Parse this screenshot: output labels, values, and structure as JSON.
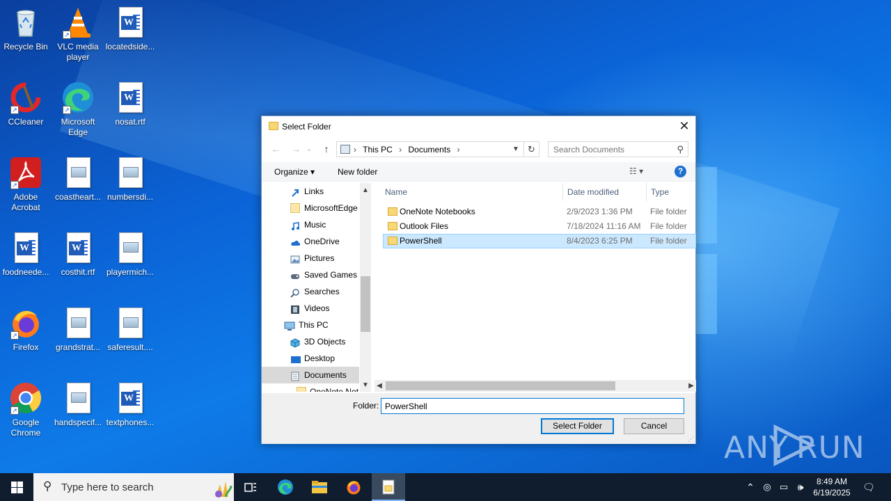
{
  "desktop": {
    "icons": [
      {
        "label": "Recycle Bin",
        "kind": "recycle"
      },
      {
        "label": "VLC media player",
        "kind": "vlc"
      },
      {
        "label": "locatedside...",
        "kind": "word"
      },
      {
        "label": "CCleaner",
        "kind": "ccleaner"
      },
      {
        "label": "Microsoft Edge",
        "kind": "edge"
      },
      {
        "label": "nosat.rtf",
        "kind": "word"
      },
      {
        "label": "Adobe Acrobat",
        "kind": "acrobat"
      },
      {
        "label": "coastheart...",
        "kind": "image"
      },
      {
        "label": "numbersdi...",
        "kind": "image"
      },
      {
        "label": "foodneede...",
        "kind": "word"
      },
      {
        "label": "costhit.rtf",
        "kind": "word"
      },
      {
        "label": "playermich...",
        "kind": "image"
      },
      {
        "label": "Firefox",
        "kind": "firefox"
      },
      {
        "label": "grandstrat...",
        "kind": "image"
      },
      {
        "label": "saferesult....",
        "kind": "image"
      },
      {
        "label": "Google Chrome",
        "kind": "chrome"
      },
      {
        "label": "handspecif...",
        "kind": "image"
      },
      {
        "label": "textphones...",
        "kind": "word"
      }
    ]
  },
  "dialog": {
    "title": "Select Folder",
    "close_glyph": "✕",
    "nav": {
      "back": "←",
      "forward": "→",
      "recent": "⌄",
      "up": "↑"
    },
    "address": {
      "crumbs": [
        "This PC",
        "Documents"
      ],
      "sep": "›"
    },
    "search_placeholder": "Search Documents",
    "toolbar": {
      "organize": "Organize ▾",
      "new_folder": "New folder",
      "view": "☷ ▾",
      "help": "?"
    },
    "nav_tree": [
      {
        "label": "Links",
        "icon": "links-icon",
        "indent": 1
      },
      {
        "label": "MicrosoftEdge",
        "icon": "folder-icon",
        "indent": 1
      },
      {
        "label": "Music",
        "icon": "music-icon",
        "indent": 1
      },
      {
        "label": "OneDrive",
        "icon": "onedrive-icon",
        "indent": 1
      },
      {
        "label": "Pictures",
        "icon": "pictures-icon",
        "indent": 1
      },
      {
        "label": "Saved Games",
        "icon": "saved-games-icon",
        "indent": 1
      },
      {
        "label": "Searches",
        "icon": "search-icon",
        "indent": 1
      },
      {
        "label": "Videos",
        "icon": "videos-icon",
        "indent": 1
      },
      {
        "label": "This PC",
        "icon": "this-pc-icon",
        "indent": 0
      },
      {
        "label": "3D Objects",
        "icon": "3d-objects-icon",
        "indent": 1
      },
      {
        "label": "Desktop",
        "icon": "desktop-icon",
        "indent": 1
      },
      {
        "label": "Documents",
        "icon": "documents-icon",
        "indent": 1,
        "selected": true
      },
      {
        "label": "OneNote Not",
        "icon": "folder-icon",
        "indent": 2
      }
    ],
    "columns": {
      "name": "Name",
      "date": "Date modified",
      "type": "Type"
    },
    "files": [
      {
        "name": "OneNote Notebooks",
        "date": "2/9/2023 1:36 PM",
        "type": "File folder"
      },
      {
        "name": "Outlook Files",
        "date": "7/18/2024 11:16 AM",
        "type": "File folder"
      },
      {
        "name": "PowerShell",
        "date": "8/4/2023 6:25 PM",
        "type": "File folder",
        "selected": true
      }
    ],
    "folder_label": "Folder:",
    "folder_value": "PowerShell",
    "select_button": "Select Folder",
    "cancel_button": "Cancel"
  },
  "taskbar": {
    "search_placeholder": "Type here to search",
    "time": "8:49 AM",
    "date": "6/19/2025"
  },
  "watermark": "ANY RUN"
}
